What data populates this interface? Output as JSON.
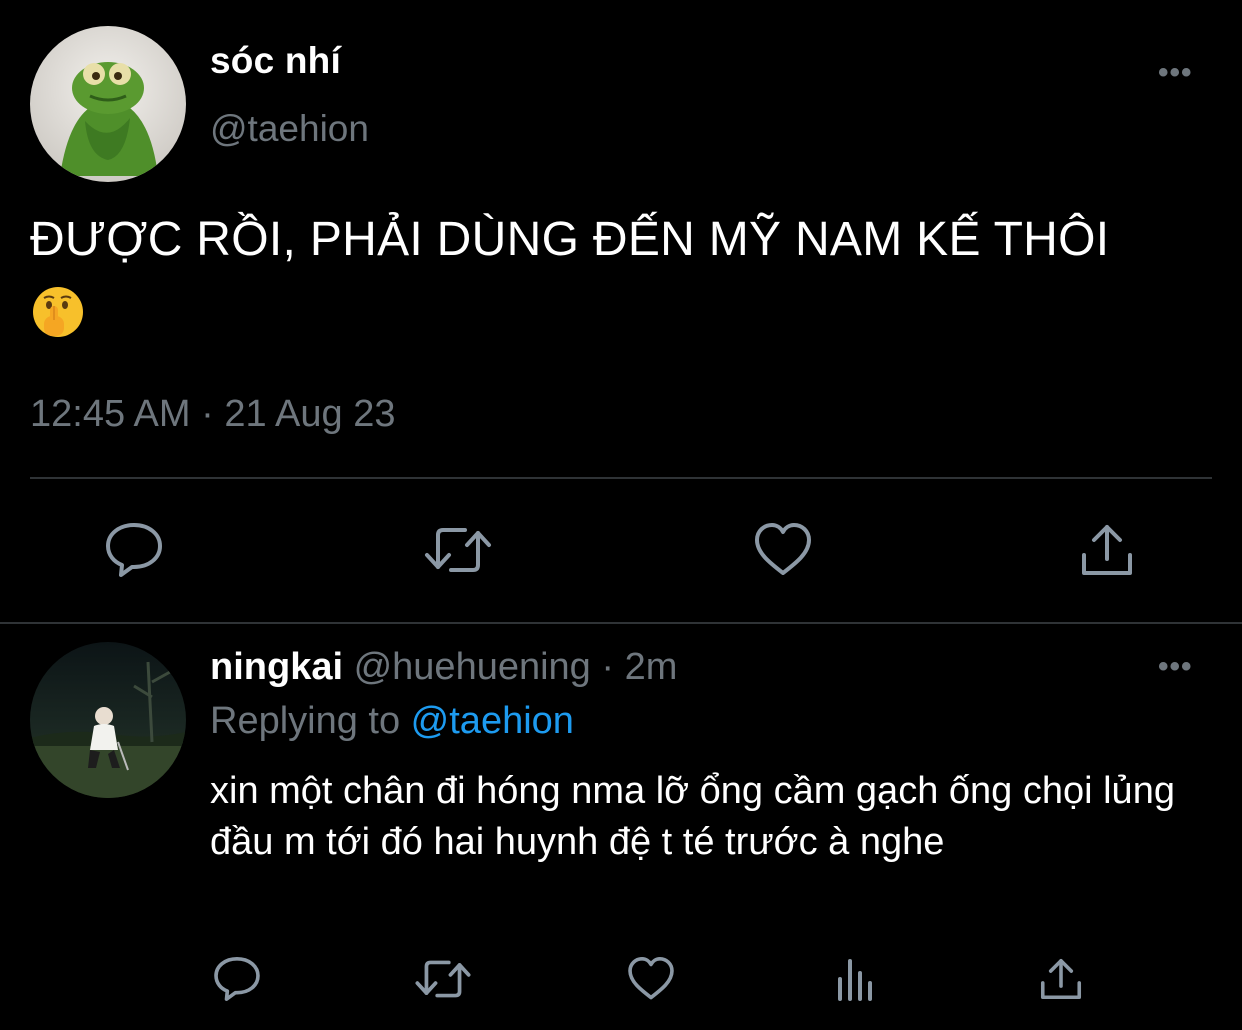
{
  "main_tweet": {
    "display_name": "sóc nhí",
    "handle": "@taehion",
    "more_label": "•••",
    "text": "ĐƯỢC RỒI, PHẢI DÙNG ĐẾN MỸ NAM KẾ THÔI",
    "emoji": "shushing-face-emoji",
    "timestamp": "12:45 AM · 21 Aug 23"
  },
  "reply_tweet": {
    "display_name": "ningkai",
    "handle": "@huehuening",
    "separator": " · ",
    "age": "2m",
    "more_label": "•••",
    "replying_prefix": "Replying to ",
    "replying_handle": "@taehion",
    "text": "xin một chân đi hóng nma lỡ ổng cầm gạch ống chọi lủng đầu m tới đó hai huynh đệ t té trước à nghe"
  },
  "icons": {
    "reply": "reply-icon",
    "retweet": "retweet-icon",
    "like": "heart-icon",
    "share": "share-icon",
    "stats": "stats-icon"
  },
  "colors": {
    "background": "#000000",
    "text_primary": "#ffffff",
    "text_secondary": "#6e767d",
    "accent": "#1d9bf0",
    "divider": "#2f3336"
  }
}
